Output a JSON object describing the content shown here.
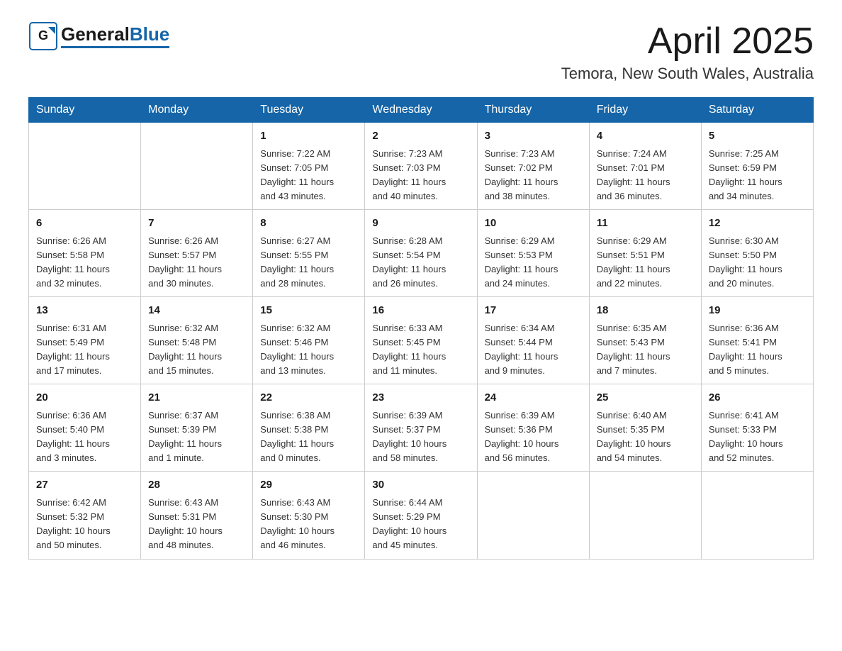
{
  "header": {
    "logo_general": "General",
    "logo_blue": "Blue",
    "month_title": "April 2025",
    "location": "Temora, New South Wales, Australia"
  },
  "weekdays": [
    "Sunday",
    "Monday",
    "Tuesday",
    "Wednesday",
    "Thursday",
    "Friday",
    "Saturday"
  ],
  "weeks": [
    [
      {
        "day": "",
        "info": ""
      },
      {
        "day": "",
        "info": ""
      },
      {
        "day": "1",
        "info": "Sunrise: 7:22 AM\nSunset: 7:05 PM\nDaylight: 11 hours\nand 43 minutes."
      },
      {
        "day": "2",
        "info": "Sunrise: 7:23 AM\nSunset: 7:03 PM\nDaylight: 11 hours\nand 40 minutes."
      },
      {
        "day": "3",
        "info": "Sunrise: 7:23 AM\nSunset: 7:02 PM\nDaylight: 11 hours\nand 38 minutes."
      },
      {
        "day": "4",
        "info": "Sunrise: 7:24 AM\nSunset: 7:01 PM\nDaylight: 11 hours\nand 36 minutes."
      },
      {
        "day": "5",
        "info": "Sunrise: 7:25 AM\nSunset: 6:59 PM\nDaylight: 11 hours\nand 34 minutes."
      }
    ],
    [
      {
        "day": "6",
        "info": "Sunrise: 6:26 AM\nSunset: 5:58 PM\nDaylight: 11 hours\nand 32 minutes."
      },
      {
        "day": "7",
        "info": "Sunrise: 6:26 AM\nSunset: 5:57 PM\nDaylight: 11 hours\nand 30 minutes."
      },
      {
        "day": "8",
        "info": "Sunrise: 6:27 AM\nSunset: 5:55 PM\nDaylight: 11 hours\nand 28 minutes."
      },
      {
        "day": "9",
        "info": "Sunrise: 6:28 AM\nSunset: 5:54 PM\nDaylight: 11 hours\nand 26 minutes."
      },
      {
        "day": "10",
        "info": "Sunrise: 6:29 AM\nSunset: 5:53 PM\nDaylight: 11 hours\nand 24 minutes."
      },
      {
        "day": "11",
        "info": "Sunrise: 6:29 AM\nSunset: 5:51 PM\nDaylight: 11 hours\nand 22 minutes."
      },
      {
        "day": "12",
        "info": "Sunrise: 6:30 AM\nSunset: 5:50 PM\nDaylight: 11 hours\nand 20 minutes."
      }
    ],
    [
      {
        "day": "13",
        "info": "Sunrise: 6:31 AM\nSunset: 5:49 PM\nDaylight: 11 hours\nand 17 minutes."
      },
      {
        "day": "14",
        "info": "Sunrise: 6:32 AM\nSunset: 5:48 PM\nDaylight: 11 hours\nand 15 minutes."
      },
      {
        "day": "15",
        "info": "Sunrise: 6:32 AM\nSunset: 5:46 PM\nDaylight: 11 hours\nand 13 minutes."
      },
      {
        "day": "16",
        "info": "Sunrise: 6:33 AM\nSunset: 5:45 PM\nDaylight: 11 hours\nand 11 minutes."
      },
      {
        "day": "17",
        "info": "Sunrise: 6:34 AM\nSunset: 5:44 PM\nDaylight: 11 hours\nand 9 minutes."
      },
      {
        "day": "18",
        "info": "Sunrise: 6:35 AM\nSunset: 5:43 PM\nDaylight: 11 hours\nand 7 minutes."
      },
      {
        "day": "19",
        "info": "Sunrise: 6:36 AM\nSunset: 5:41 PM\nDaylight: 11 hours\nand 5 minutes."
      }
    ],
    [
      {
        "day": "20",
        "info": "Sunrise: 6:36 AM\nSunset: 5:40 PM\nDaylight: 11 hours\nand 3 minutes."
      },
      {
        "day": "21",
        "info": "Sunrise: 6:37 AM\nSunset: 5:39 PM\nDaylight: 11 hours\nand 1 minute."
      },
      {
        "day": "22",
        "info": "Sunrise: 6:38 AM\nSunset: 5:38 PM\nDaylight: 11 hours\nand 0 minutes."
      },
      {
        "day": "23",
        "info": "Sunrise: 6:39 AM\nSunset: 5:37 PM\nDaylight: 10 hours\nand 58 minutes."
      },
      {
        "day": "24",
        "info": "Sunrise: 6:39 AM\nSunset: 5:36 PM\nDaylight: 10 hours\nand 56 minutes."
      },
      {
        "day": "25",
        "info": "Sunrise: 6:40 AM\nSunset: 5:35 PM\nDaylight: 10 hours\nand 54 minutes."
      },
      {
        "day": "26",
        "info": "Sunrise: 6:41 AM\nSunset: 5:33 PM\nDaylight: 10 hours\nand 52 minutes."
      }
    ],
    [
      {
        "day": "27",
        "info": "Sunrise: 6:42 AM\nSunset: 5:32 PM\nDaylight: 10 hours\nand 50 minutes."
      },
      {
        "day": "28",
        "info": "Sunrise: 6:43 AM\nSunset: 5:31 PM\nDaylight: 10 hours\nand 48 minutes."
      },
      {
        "day": "29",
        "info": "Sunrise: 6:43 AM\nSunset: 5:30 PM\nDaylight: 10 hours\nand 46 minutes."
      },
      {
        "day": "30",
        "info": "Sunrise: 6:44 AM\nSunset: 5:29 PM\nDaylight: 10 hours\nand 45 minutes."
      },
      {
        "day": "",
        "info": ""
      },
      {
        "day": "",
        "info": ""
      },
      {
        "day": "",
        "info": ""
      }
    ]
  ]
}
